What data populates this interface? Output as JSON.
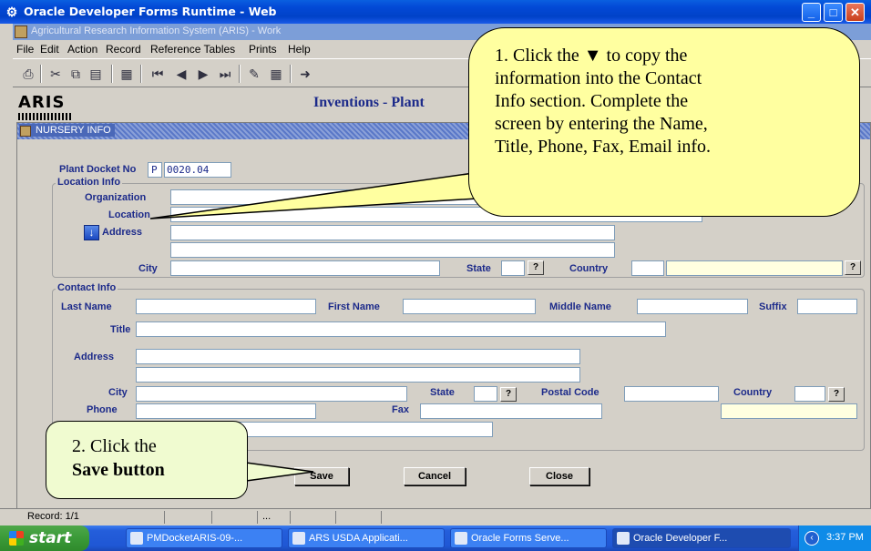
{
  "window": {
    "title": "Oracle Developer Forms Runtime - Web"
  },
  "inner_window": {
    "title": "Agricultural Research Information System (ARIS) - Work"
  },
  "menu": [
    "File",
    "Edit",
    "Action",
    "Record",
    "Reference Tables",
    "Prints",
    "Help"
  ],
  "toolbar_icons": [
    "print-icon",
    "cut-icon",
    "copy-icon",
    "paste-icon",
    "query-icon",
    "first-record-icon",
    "previous-record-icon",
    "next-record-icon",
    "last-record-icon",
    "edit-icon",
    "list-of-values-icon",
    "exit-icon"
  ],
  "back_form": {
    "logo": "ARIS",
    "heading": "Inventions - Plant"
  },
  "nursery": {
    "title": "NURSERY INFO",
    "plant_docket_label": "Plant Docket No",
    "plant_docket_prefix": "P",
    "plant_docket_value": "0020.04",
    "location_group": "Location Info",
    "organization_label": "Organization",
    "location_label": "Location",
    "address_label": "Address",
    "city_label": "City",
    "state_label": "State",
    "country_label": "Country",
    "lov_symbol": "?",
    "copy_arrow": "↓",
    "contact_group": "Contact Info",
    "last_name_label": "Last Name",
    "first_name_label": "First Name",
    "middle_name_label": "Middle Name",
    "suffix_label": "Suffix",
    "title_label": "Title",
    "postal_code_label": "Postal Code",
    "phone_label": "Phone",
    "fax_label": "Fax",
    "buttons": {
      "save": "Save",
      "cancel": "Cancel",
      "close": "Close"
    }
  },
  "status": {
    "record": "Record: 1/1",
    "dots": "..."
  },
  "taskbar": {
    "start": "start",
    "tasks": [
      "PMDocketARIS-09-...",
      "ARS USDA Applicati...",
      "Oracle Forms Serve...",
      "Oracle Developer F..."
    ],
    "clock": "3:37 PM"
  },
  "callouts": {
    "one_line1": "1. Click the ▼ to copy the",
    "one_line2": "information into the Contact",
    "one_line3": "Info section. Complete the",
    "one_line4": "screen by entering the Name,",
    "one_line5": "Title, Phone, Fax, Email info.",
    "two_line1": "2. Click the",
    "two_line2": "Save button"
  },
  "colors": {
    "label_blue": "#1c2a8a",
    "callout_yellow": "#ffffa0",
    "xp_blue": "#0349d6"
  }
}
